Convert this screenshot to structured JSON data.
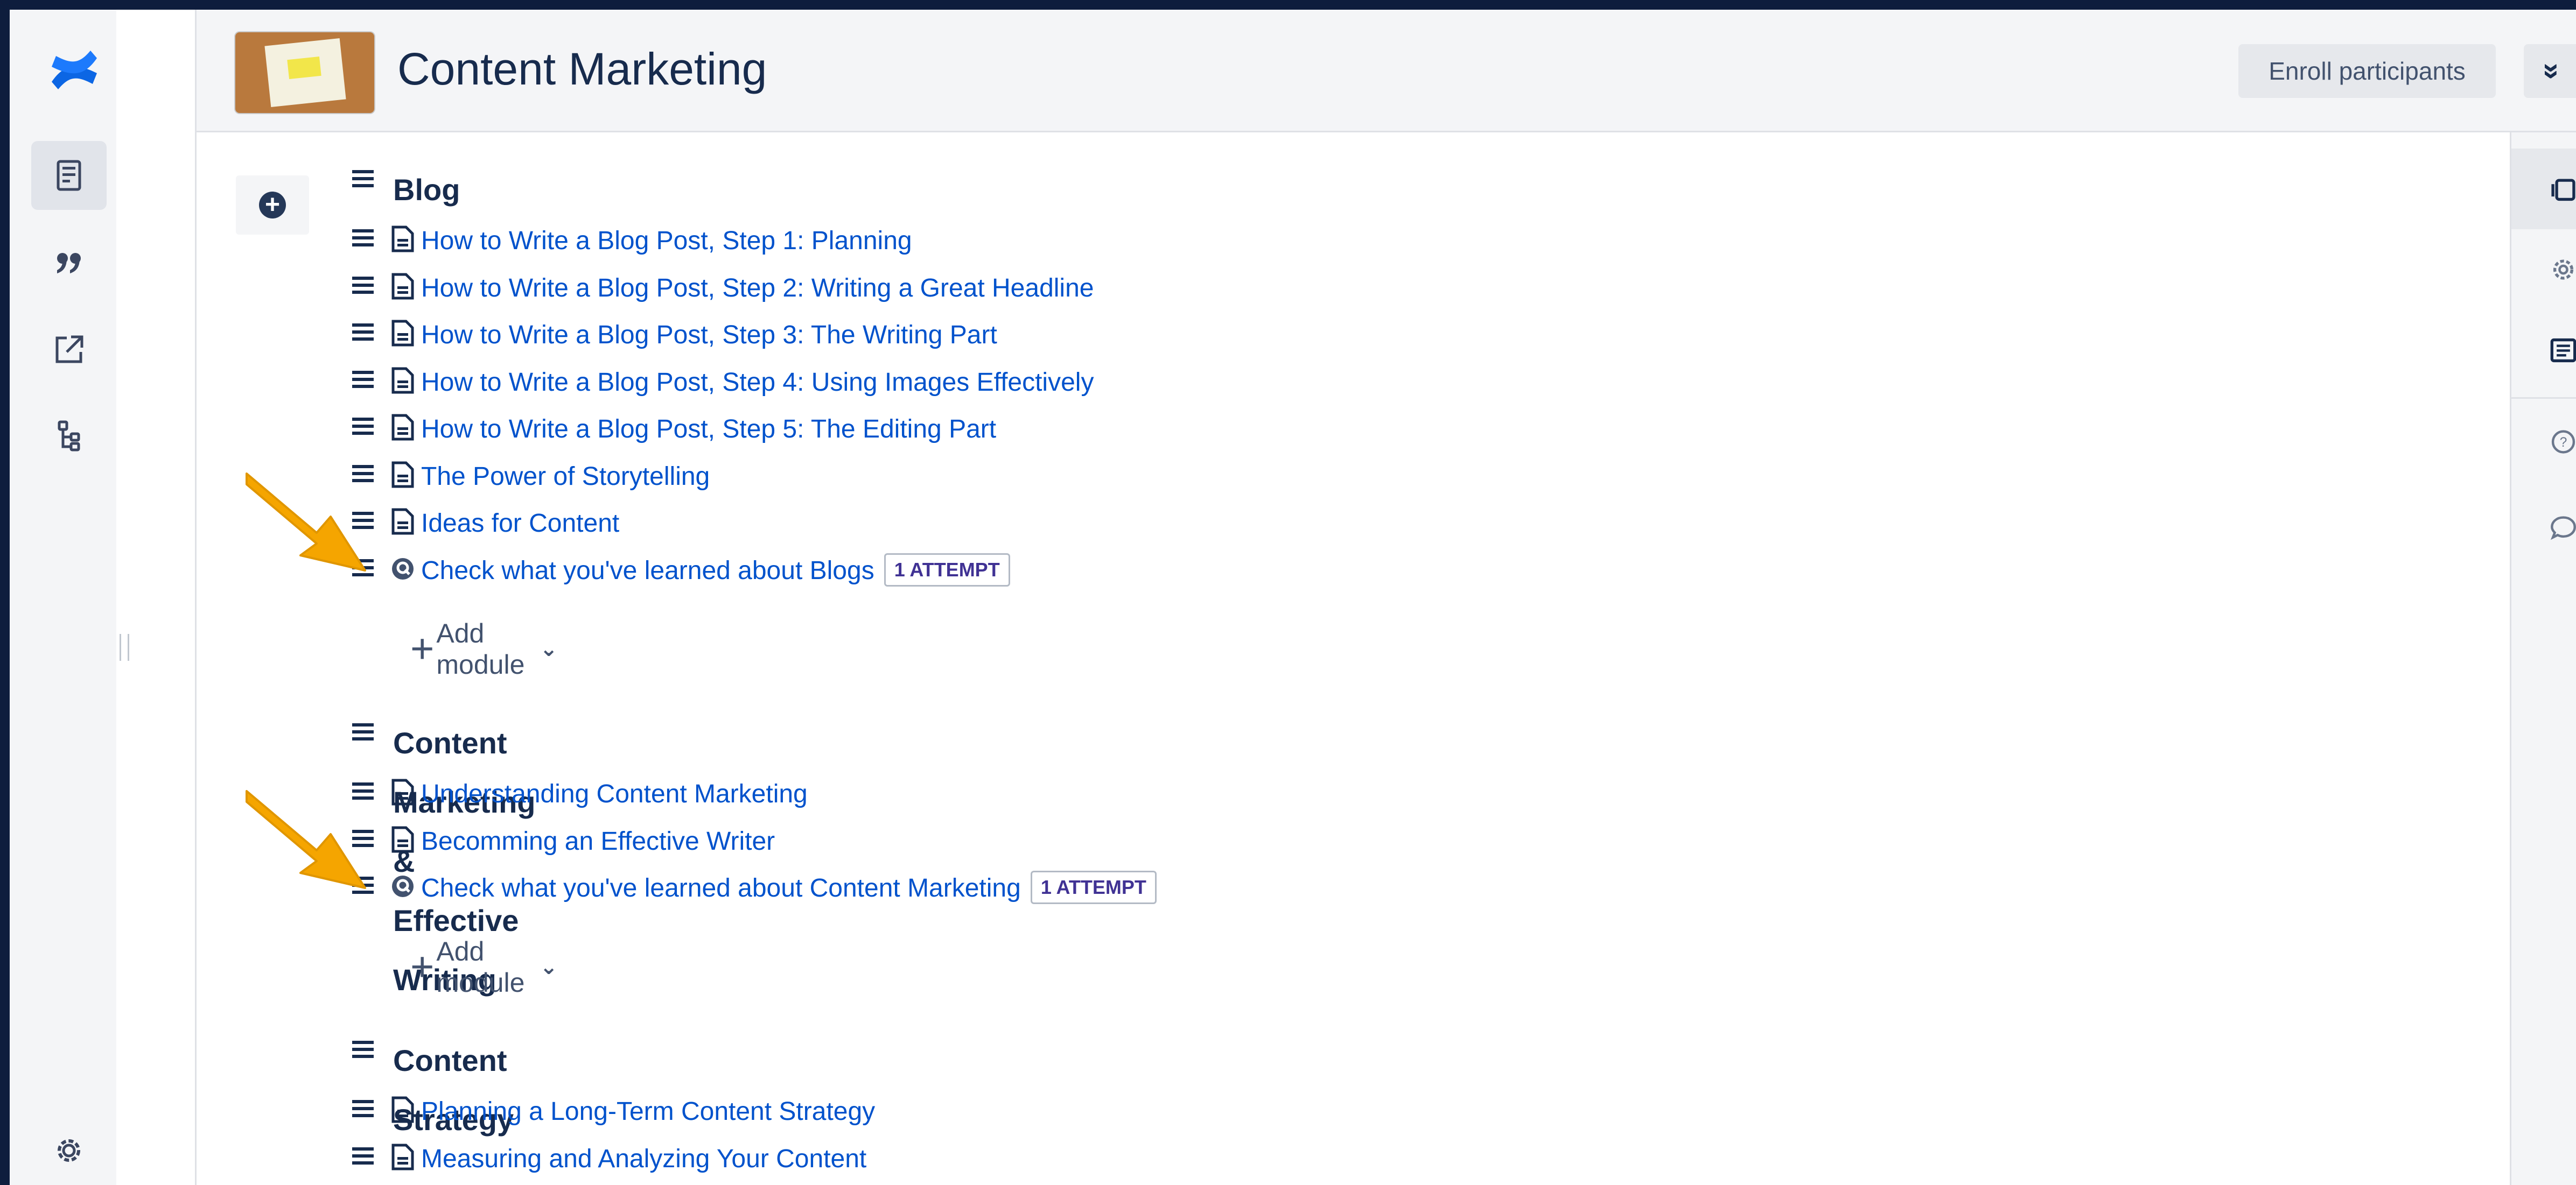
{
  "header": {
    "title": "Content Marketing",
    "enroll_label": "Enroll participants",
    "collapse_glyph": "»"
  },
  "sections": [
    {
      "title": "Blog",
      "items": [
        {
          "label": "How to Write a Blog Post, Step 1: Planning",
          "type": "page"
        },
        {
          "label": "How to Write a Blog Post, Step 2: Writing a Great Headline",
          "type": "page"
        },
        {
          "label": "How to Write a Blog Post, Step 3: The Writing Part",
          "type": "page"
        },
        {
          "label": "How to Write a Blog Post, Step 4: Using Images Effectively",
          "type": "page"
        },
        {
          "label": "How to Write a Blog Post, Step 5: The Editing Part",
          "type": "page"
        },
        {
          "label": "The Power of Storytelling",
          "type": "page"
        },
        {
          "label": "Ideas for Content",
          "type": "page"
        },
        {
          "label": "Check what you've learned about Blogs",
          "type": "quiz",
          "badge": "1 ATTEMPT"
        }
      ],
      "add_module_label": "Add module"
    },
    {
      "title": "Content Marketing & Effective Writing",
      "items": [
        {
          "label": "Understanding Content Marketing",
          "type": "page"
        },
        {
          "label": "Becomming an Effective Writer",
          "type": "page"
        },
        {
          "label": "Check what you've learned about Content Marketing",
          "type": "quiz",
          "badge": "1 ATTEMPT"
        }
      ],
      "add_module_label": "Add module"
    },
    {
      "title": "Content Strategy",
      "items": [
        {
          "label": "Planning a Long-Term Content Strategy",
          "type": "page"
        },
        {
          "label": "Measuring and Analyzing Your Content",
          "type": "page"
        }
      ]
    }
  ],
  "rail_icons": [
    "confluence-logo-icon",
    "pages-icon",
    "quote-icon",
    "external-link-icon",
    "hierarchy-icon",
    "settings-icon"
  ],
  "right_rail_icons": [
    "copy-icon",
    "settings-icon",
    "list-icon",
    "help-icon",
    "comment-icon"
  ],
  "colors": {
    "link": "#0052cc",
    "heading": "#172b4d",
    "badge_text": "#403294",
    "arrow": "#f5a500",
    "frame": "#0e1d3d"
  }
}
